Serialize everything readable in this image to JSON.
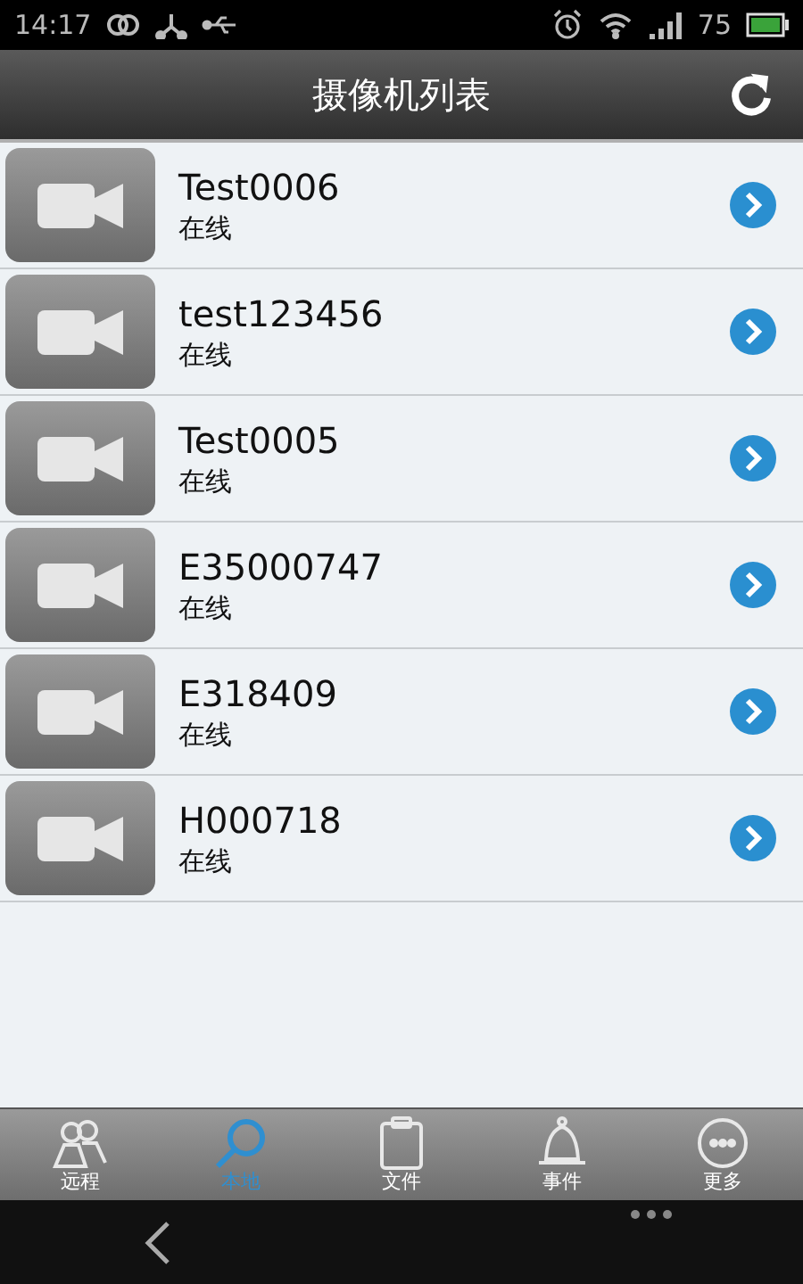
{
  "status_bar": {
    "time": "14:17",
    "battery": "75"
  },
  "header": {
    "title": "摄像机列表"
  },
  "cameras": [
    {
      "name": "Test0006",
      "status": "在线"
    },
    {
      "name": "test123456",
      "status": "在线"
    },
    {
      "name": "Test0005",
      "status": "在线"
    },
    {
      "name": "E35000747",
      "status": "在线"
    },
    {
      "name": "E318409",
      "status": "在线"
    },
    {
      "name": "H000718",
      "status": "在线"
    }
  ],
  "tabs": [
    {
      "label": "远程",
      "kind": "people",
      "selected": false
    },
    {
      "label": "本地",
      "kind": "search",
      "selected": true
    },
    {
      "label": "文件",
      "kind": "clipboard",
      "selected": false
    },
    {
      "label": "事件",
      "kind": "bell",
      "selected": false
    },
    {
      "label": "更多",
      "kind": "more",
      "selected": false
    }
  ]
}
